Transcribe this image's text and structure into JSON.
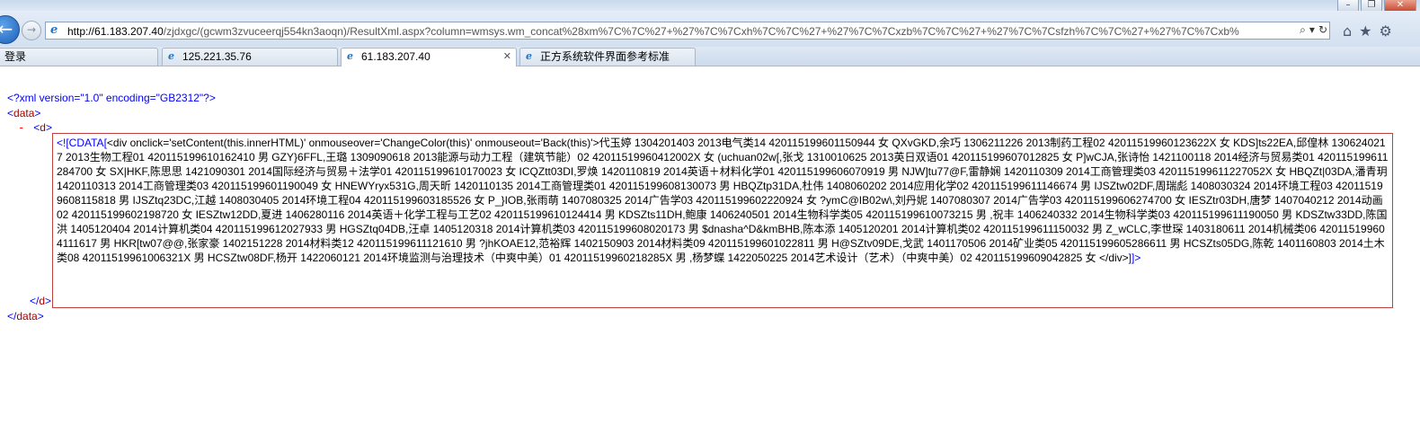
{
  "browser": {
    "url_host": "http://61.183.207.40",
    "url_rest": "/zjdxgc/(gcwm3zvuceerqj554kn3aoqn)/ResultXml.aspx?column=wmsys.wm_concat%28xm%7C%7C%27+%27%7C%7Cxh%7C%7C%27+%27%7C%7Cxzb%7C%7C%27+%27%7C%7Csfzh%7C%7C%27+%27%7C%7Cxb%",
    "tabs": [
      {
        "label": "登录",
        "active": false
      },
      {
        "label": "125.221.35.76",
        "active": false
      },
      {
        "label": "61.183.207.40",
        "active": true
      },
      {
        "label": "正方系统软件界面参考标准",
        "active": false
      }
    ],
    "icons": [
      "back-icon",
      "forward-icon",
      "ie-page-icon",
      "search-icon",
      "dropdown-icon",
      "refresh-icon",
      "home-icon",
      "favorites-star-icon",
      "tools-gear-icon"
    ]
  },
  "xml": {
    "declaration": "<?xml version=\"1.0\" encoding=\"GB2312\"?>",
    "root_tag": "data",
    "child_tag": "d",
    "collapse_glyph": "-",
    "cdata_open": "<![CDATA[",
    "cdata_close": "]]>",
    "cdata_content": "<div onclick='setContent(this.innerHTML)' onmouseover='ChangeColor(this)' onmouseout='Back(this)'>代玉婷 1304201403 2013电气类14 420115199601150944 女 QXvGKD,余巧 1306211226 2013制药工程02 42011519960123622X 女 KDS]ts22EA,邱偟林 1306240217 2013生物工程01 420115199610162410 男 GZY}6FFL,王璐 1309090618 2013能源与动力工程（建筑节能）02 420115199604120​02X 女 (uchuan02w[,张戈 1310010625 2013英日双语01 420115199607012825 女 P]wCJA,张诗怡 1421100118 2014经济与贸易类01 420115199611284700 女 SX|HKF,陈思思 1421090301 2014国际经济与贸易＋法学01 420115199610170023 女 ICQZtt03DI,罗焕 1420110819 2014英语＋材料化学01 420115199606070919 男 NJW]tu77@F,雷静娴 1420110309 2014工商管理类03 420115199611227052X 女 HBQZt|03DA,潘青玥 1420110313 2014工商管理类03 420115199601190049 女 HNEWYryx531G,周天昕 1420110135 2014工商管理类01 420115199608130073 男 HBQZtp31DA,杜伟 1408060202 2014应用化学02 420115199611146674 男 IJSZtw02DF,周瑞彪 1408030324 2014环境工程03 420115199608115818 男 IJSZtq23DC,江越 1408030405 2014环境工程04 420115199603185526 女 P_}IOB,张雨萌 1407080325 2014广告学03 420115199602220924 女 ?ymC@IB02w\\,刘丹妮 1407080307 2014广告学03 420115199606274700 女 IESZtr03DH,唐梦 1407040212 2014动画02 420115199602198720 女 IESZtw12DD,夏进 1406280116 2014英语＋化学工程与工艺02 420115199610124414 男 KDSZts11DH,鲍康 1406240501 2014生物科学类05 420115199610073215 男 ,祝丰 1406240332 2014生物科学类03 420115199611190050 男 KDSZtw33DD,陈国洪 1405120404 2014计算机类04 420115199612027933 男 HGSZtq04DB,汪卓 1405120318 2014计算机类03 420115199608020173 男 $dnasha^D&kmBHB,陈本添 1405120201 2014计算机类02 420115199611150032 男 Z_wCLC,李世琛 1403180611 2014机械类06 420115199604111617 男 HKR[tw07@@,张家豪 1402151228 2014材料类12 420115199611121610 男 ?jhKOAE12,范裕辉 1402150903 2014材料类09 420115199601022811 男 H@SZtv09DE,戈武 1401170506 2014矿业类05 420115199605286611 男 HCSZts05DG,陈乾 1401160803 2014土木类08 42011519961006321X 男 HCSZtw08DF,杨开 1422060121 2014环境监测与治理技术（中爽中美）01 42011519960218285X 男 ,杨梦蝶 1422050225 2014艺术设计（艺术）（中爽中美）02 420115199609042825 女 </div>"
  }
}
